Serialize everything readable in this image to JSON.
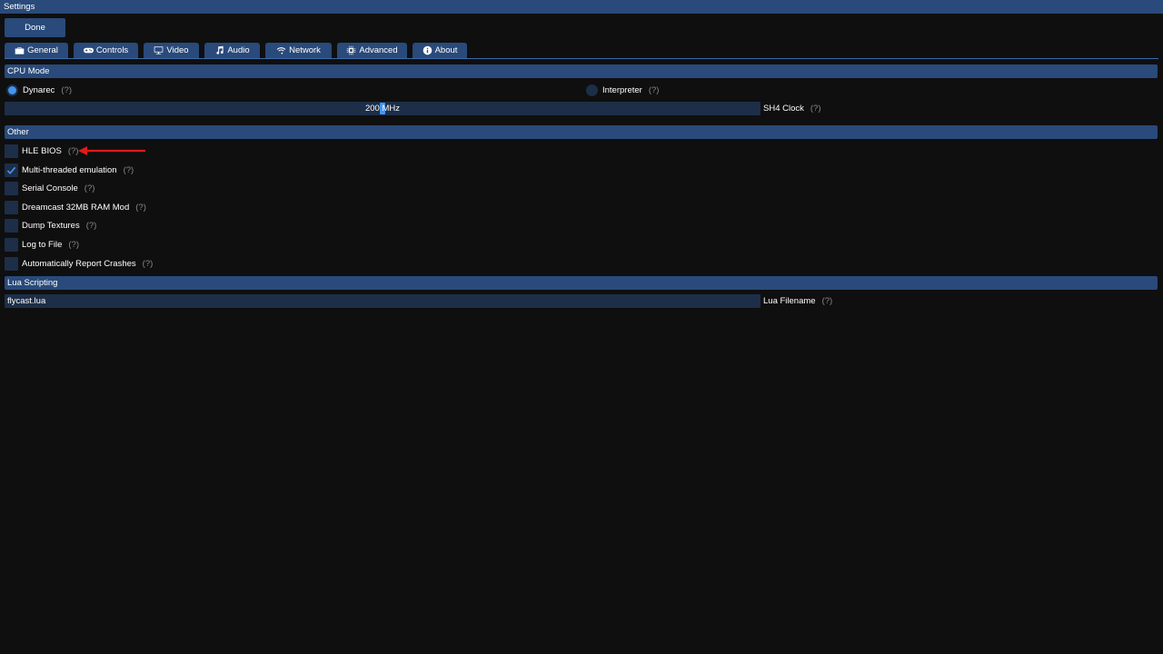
{
  "window": {
    "title": "Settings"
  },
  "toolbar": {
    "done_label": "Done"
  },
  "tabs": [
    {
      "label": "General",
      "icon": "toolbox-icon"
    },
    {
      "label": "Controls",
      "icon": "gamepad-icon"
    },
    {
      "label": "Video",
      "icon": "monitor-icon"
    },
    {
      "label": "Audio",
      "icon": "music-note-icon"
    },
    {
      "label": "Network",
      "icon": "wifi-icon"
    },
    {
      "label": "Advanced",
      "icon": "microchip-icon",
      "active": true
    },
    {
      "label": "About",
      "icon": "info-icon"
    }
  ],
  "cpu_mode": {
    "header": "CPU Mode",
    "options": [
      {
        "label": "Dynarec",
        "help": "(?)",
        "selected": true
      },
      {
        "label": "Interpreter",
        "help": "(?)",
        "selected": false
      }
    ],
    "sh4_clock": {
      "value_text": "200 MHz",
      "label": "SH4 Clock",
      "help": "(?)",
      "level_percent": 50
    }
  },
  "other": {
    "header": "Other",
    "options": [
      {
        "label": "HLE BIOS",
        "help": "(?)",
        "checked": false
      },
      {
        "label": "Multi-threaded emulation",
        "help": "(?)",
        "checked": true
      },
      {
        "label": "Serial Console",
        "help": "(?)",
        "checked": false
      },
      {
        "label": "Dreamcast 32MB RAM Mod",
        "help": "(?)",
        "checked": false
      },
      {
        "label": "Dump Textures",
        "help": "(?)",
        "checked": false
      },
      {
        "label": "Log to File",
        "help": "(?)",
        "checked": false
      },
      {
        "label": "Automatically Report Crashes",
        "help": "(?)",
        "checked": false
      }
    ]
  },
  "lua_scripting": {
    "header": "Lua Scripting",
    "filename_value": "flycast.lua",
    "filename_label": "Lua Filename",
    "help": "(?)"
  },
  "colors": {
    "accent": "#294a7a",
    "frame": "#1d2e48",
    "check_mark": "#4295f0",
    "annotation_arrow": "#e01a1a",
    "background": "#0f0f0f"
  }
}
